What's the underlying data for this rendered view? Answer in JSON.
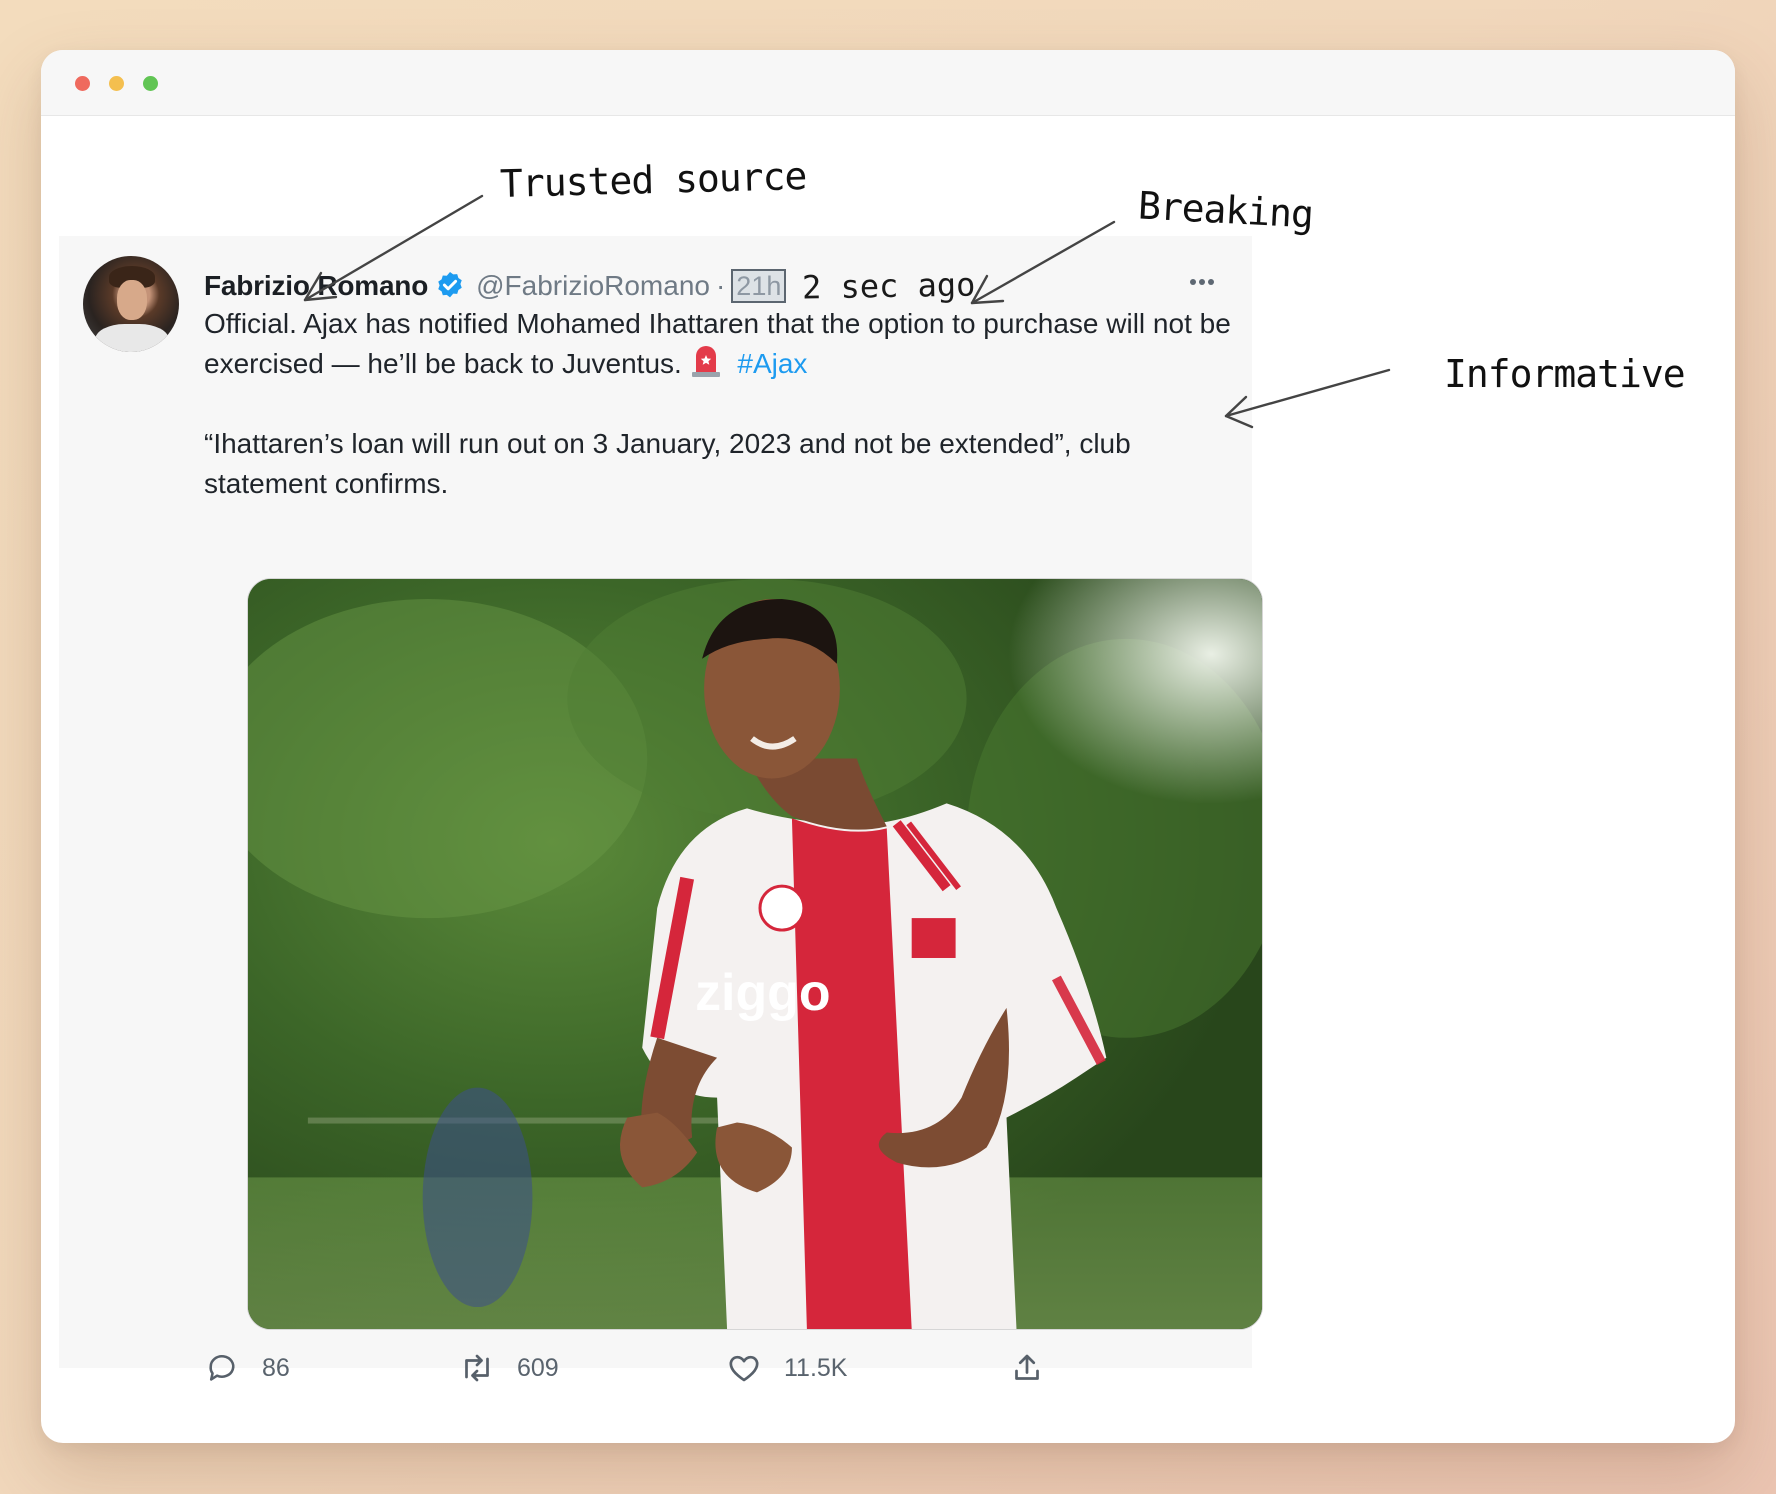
{
  "window": {
    "controls": [
      "close",
      "minimize",
      "zoom"
    ]
  },
  "annotations": {
    "trusted": "Trusted source",
    "breaking": "Breaking",
    "informative": "Informative"
  },
  "tweet": {
    "author_name": "Fabrizio Romano",
    "verified_icon": "verified-badge-icon",
    "handle": "@FabrizioRomano",
    "separator": "·",
    "time": "21h",
    "handwritten_time": "2 sec ago",
    "text_p1": "Official. Ajax has notified Mohamed Ihattaren that the option to purchase will not be exercised — he’ll be back to Juventus.",
    "emoji_icon": "siren-icon",
    "hashtag": "#Ajax",
    "text_p2": "“Ihattaren’s loan will run out on 3 January, 2023 and not be extended”, club statement confirms.",
    "actions": {
      "reply_count": "86",
      "retweet_count": "609",
      "like_count": "11.5K"
    },
    "colors": {
      "link": "#1d9bf0",
      "verified": "#1d9bf0"
    }
  }
}
